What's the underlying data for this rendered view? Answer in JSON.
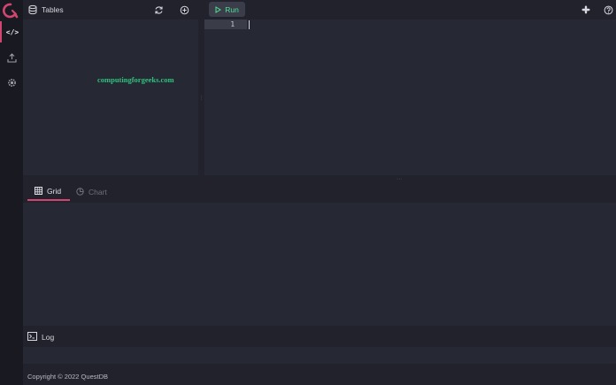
{
  "header": {
    "tables_label": "Tables",
    "run_label": "Run"
  },
  "schema": {
    "watermark": "computingforgeeks.com"
  },
  "editor": {
    "line_number": "1"
  },
  "results": {
    "tabs": [
      {
        "label": "Grid",
        "icon": "grid-icon",
        "active": true
      },
      {
        "label": "Chart",
        "icon": "chart-icon",
        "active": false
      }
    ]
  },
  "log": {
    "label": "Log"
  },
  "footer": {
    "copyright": "Copyright © 2022 QuestDB"
  },
  "colors": {
    "accent": "#d14671",
    "run": "#50e094",
    "watermark": "#2ec27e",
    "panel": "#262833",
    "background": "#21222c"
  }
}
